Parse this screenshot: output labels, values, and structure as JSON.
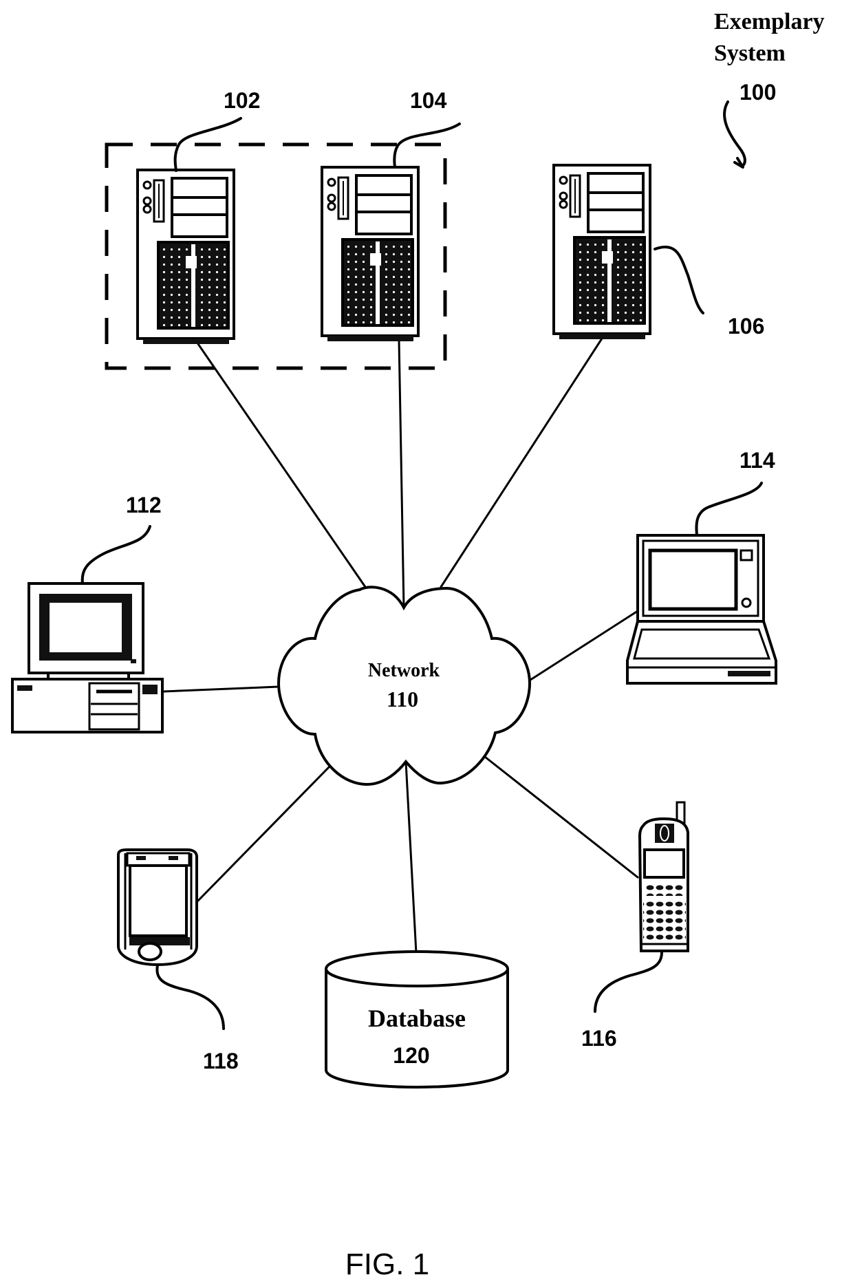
{
  "figure": {
    "title_line1": "Exemplary",
    "title_line2": "System",
    "system_ref": "100",
    "caption": "FIG. 1"
  },
  "nodes": {
    "server_102": {
      "ref": "102",
      "type": "server-tower",
      "grouped": true
    },
    "server_104": {
      "ref": "104",
      "type": "server-tower",
      "grouped": true
    },
    "server_106": {
      "ref": "106",
      "type": "server-tower",
      "grouped": false
    },
    "network_110": {
      "label": "Network",
      "ref": "110",
      "type": "cloud"
    },
    "desktop_112": {
      "ref": "112",
      "type": "desktop-computer"
    },
    "laptop_114": {
      "ref": "114",
      "type": "laptop"
    },
    "phone_116": {
      "ref": "116",
      "type": "mobile-phone"
    },
    "pda_118": {
      "ref": "118",
      "type": "pda"
    },
    "database_120": {
      "label": "Database",
      "ref": "120",
      "type": "database-cylinder"
    }
  },
  "connections": [
    [
      "server_102",
      "network_110"
    ],
    [
      "server_104",
      "network_110"
    ],
    [
      "server_106",
      "network_110"
    ],
    [
      "desktop_112",
      "network_110"
    ],
    [
      "laptop_114",
      "network_110"
    ],
    [
      "phone_116",
      "network_110"
    ],
    [
      "pda_118",
      "network_110"
    ],
    [
      "database_120",
      "network_110"
    ]
  ],
  "groups": [
    {
      "name": "server-group",
      "members": [
        "server_102",
        "server_104"
      ],
      "style": "dashed"
    }
  ]
}
